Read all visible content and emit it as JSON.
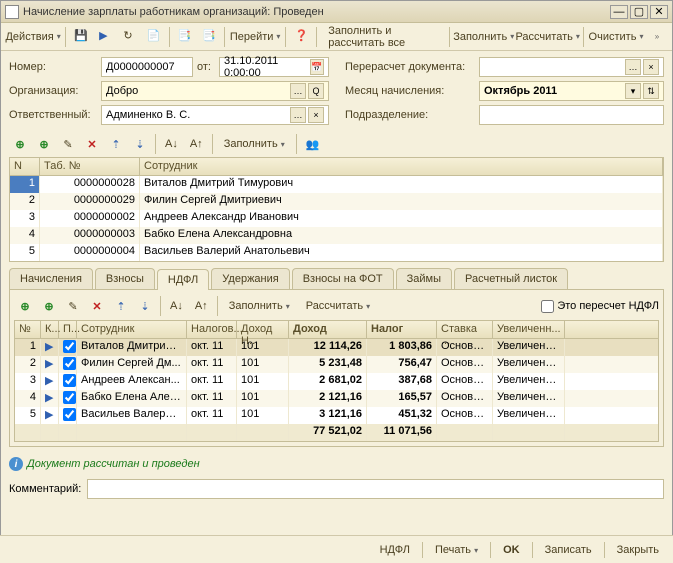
{
  "window": {
    "title": "Начисление зарплаты работникам организаций: Проведен"
  },
  "toolbar": {
    "actions": "Действия",
    "goto": "Перейти",
    "fill_calc_all": "Заполнить и рассчитать все",
    "fill": "Заполнить",
    "calc": "Рассчитать",
    "clear": "Очистить"
  },
  "form": {
    "number_label": "Номер:",
    "number": "Д0000000007",
    "date_label": "от:",
    "date": "31.10.2011 0:00:00",
    "recalc_label": "Перерасчет документа:",
    "org_label": "Организация:",
    "org": "Добро",
    "month_label": "Месяц начисления:",
    "month": "Октябрь 2011",
    "resp_label": "Ответственный:",
    "resp": "Админенко В. С.",
    "subdiv_label": "Подразделение:"
  },
  "toolbar2": {
    "fill": "Заполнить"
  },
  "grid1": {
    "headers": {
      "n": "N",
      "tab": "Таб. №",
      "emp": "Сотрудник"
    },
    "rows": [
      {
        "n": "1",
        "tab": "0000000028",
        "emp": "Виталов Дмитрий Тимурович"
      },
      {
        "n": "2",
        "tab": "0000000029",
        "emp": "Филин Сергей Дмитриевич"
      },
      {
        "n": "3",
        "tab": "0000000002",
        "emp": "Андреев Александр Иванович"
      },
      {
        "n": "4",
        "tab": "0000000003",
        "emp": "Бабко Елена Александровна"
      },
      {
        "n": "5",
        "tab": "0000000004",
        "emp": "Васильев Валерий Анатольевич"
      }
    ]
  },
  "tabs": {
    "accruals": "Начисления",
    "contrib": "Взносы",
    "ndfl": "НДФЛ",
    "deduct": "Удержания",
    "fot": "Взносы на ФОТ",
    "loans": "Займы",
    "payslip": "Расчетный листок"
  },
  "tab_toolbar": {
    "fill": "Заполнить",
    "calc": "Рассчитать",
    "recalc_ndfl": "Это пересчет НДФЛ"
  },
  "grid2": {
    "headers": {
      "n": "№",
      "k": "К...",
      "p": "П...",
      "emp": "Сотрудник",
      "nal": "Налогов...",
      "doh": "Доход Н...",
      "dohod": "Доход",
      "nalog": "Налог",
      "stav": "Ставка ...",
      "uvel": "Увеличенн..."
    },
    "rows": [
      {
        "n": "1",
        "emp": "Виталов Дмитрий ...",
        "nal": "окт. 11",
        "doh": "101",
        "dohod": "12 114,26",
        "nalog": "1 803,86",
        "stav": "Основная",
        "uvel": "Увеличенн..."
      },
      {
        "n": "2",
        "emp": "Филин Сергей Дм...",
        "nal": "окт. 11",
        "doh": "101",
        "dohod": "5 231,48",
        "nalog": "756,47",
        "stav": "Основная",
        "uvel": "Увеличенн..."
      },
      {
        "n": "3",
        "emp": "Андреев Алексан...",
        "nal": "окт. 11",
        "doh": "101",
        "dohod": "2 681,02",
        "nalog": "387,68",
        "stav": "Основная",
        "uvel": "Увеличенн..."
      },
      {
        "n": "4",
        "emp": "Бабко Елена Алек...",
        "nal": "окт. 11",
        "doh": "101",
        "dohod": "2 121,16",
        "nalog": "165,57",
        "stav": "Основная",
        "uvel": "Увеличенн..."
      },
      {
        "n": "5",
        "emp": "Васильев Валерий...",
        "nal": "окт. 11",
        "doh": "101",
        "dohod": "3 121,16",
        "nalog": "451,32",
        "stav": "Основная",
        "uvel": "Увеличенн..."
      }
    ],
    "totals": {
      "dohod": "77 521,02",
      "nalog": "11 071,56"
    }
  },
  "status": {
    "text": "Документ рассчитан и проведен"
  },
  "comment": {
    "label": "Комментарий:"
  },
  "footer": {
    "ndfl": "НДФЛ",
    "print": "Печать",
    "ok": "OK",
    "save": "Записать",
    "close": "Закрыть"
  }
}
